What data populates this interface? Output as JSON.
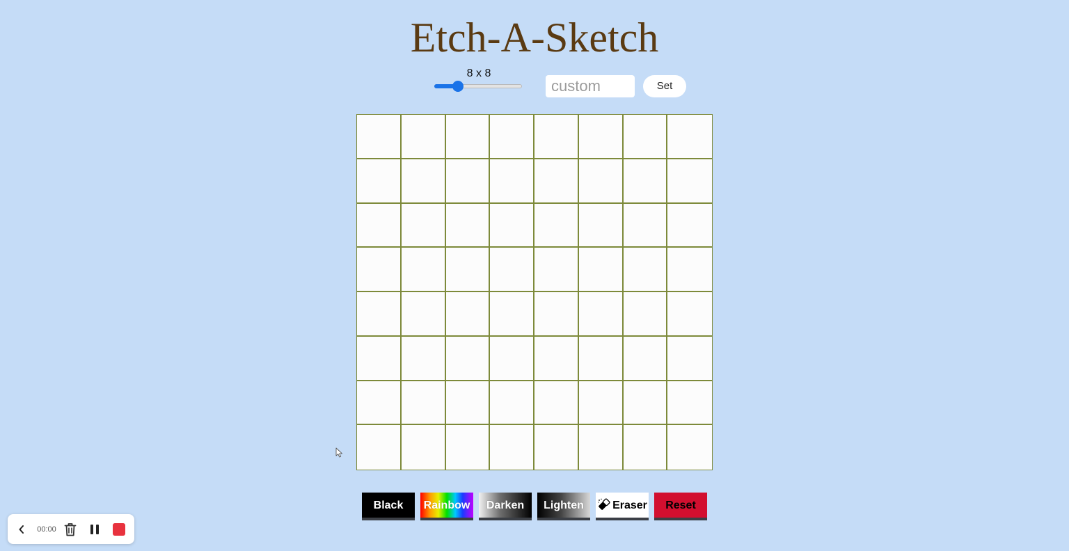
{
  "title": "Etch-A-Sketch",
  "size_control": {
    "label": "8 x 8",
    "slider": {
      "value": 8,
      "min": 2,
      "max": 32,
      "fill_fraction": 0.27
    },
    "custom_placeholder": "custom",
    "custom_value": "",
    "set_label": "Set"
  },
  "grid": {
    "rows": 8,
    "cols": 8,
    "cell_color": "#fcfcfc",
    "line_color": "#7d8a3a"
  },
  "toolbar": {
    "black_label": "Black",
    "rainbow_label": "Rainbow",
    "darken_label": "Darken",
    "lighten_label": "Lighten",
    "eraser_label": "Eraser",
    "eraser_icon": "eraser-icon",
    "reset_label": "Reset"
  },
  "recorder": {
    "back_icon": "chevron-left-icon",
    "time": "00:00",
    "trash_icon": "trash-icon",
    "pause_icon": "pause-icon",
    "stop_icon": "stop-icon"
  },
  "colors": {
    "background": "#c5dcf7",
    "title": "#5a3a12",
    "slider_accent": "#1a73e8",
    "reset_button": "#d20f2f",
    "stop_button": "#e8323e"
  }
}
